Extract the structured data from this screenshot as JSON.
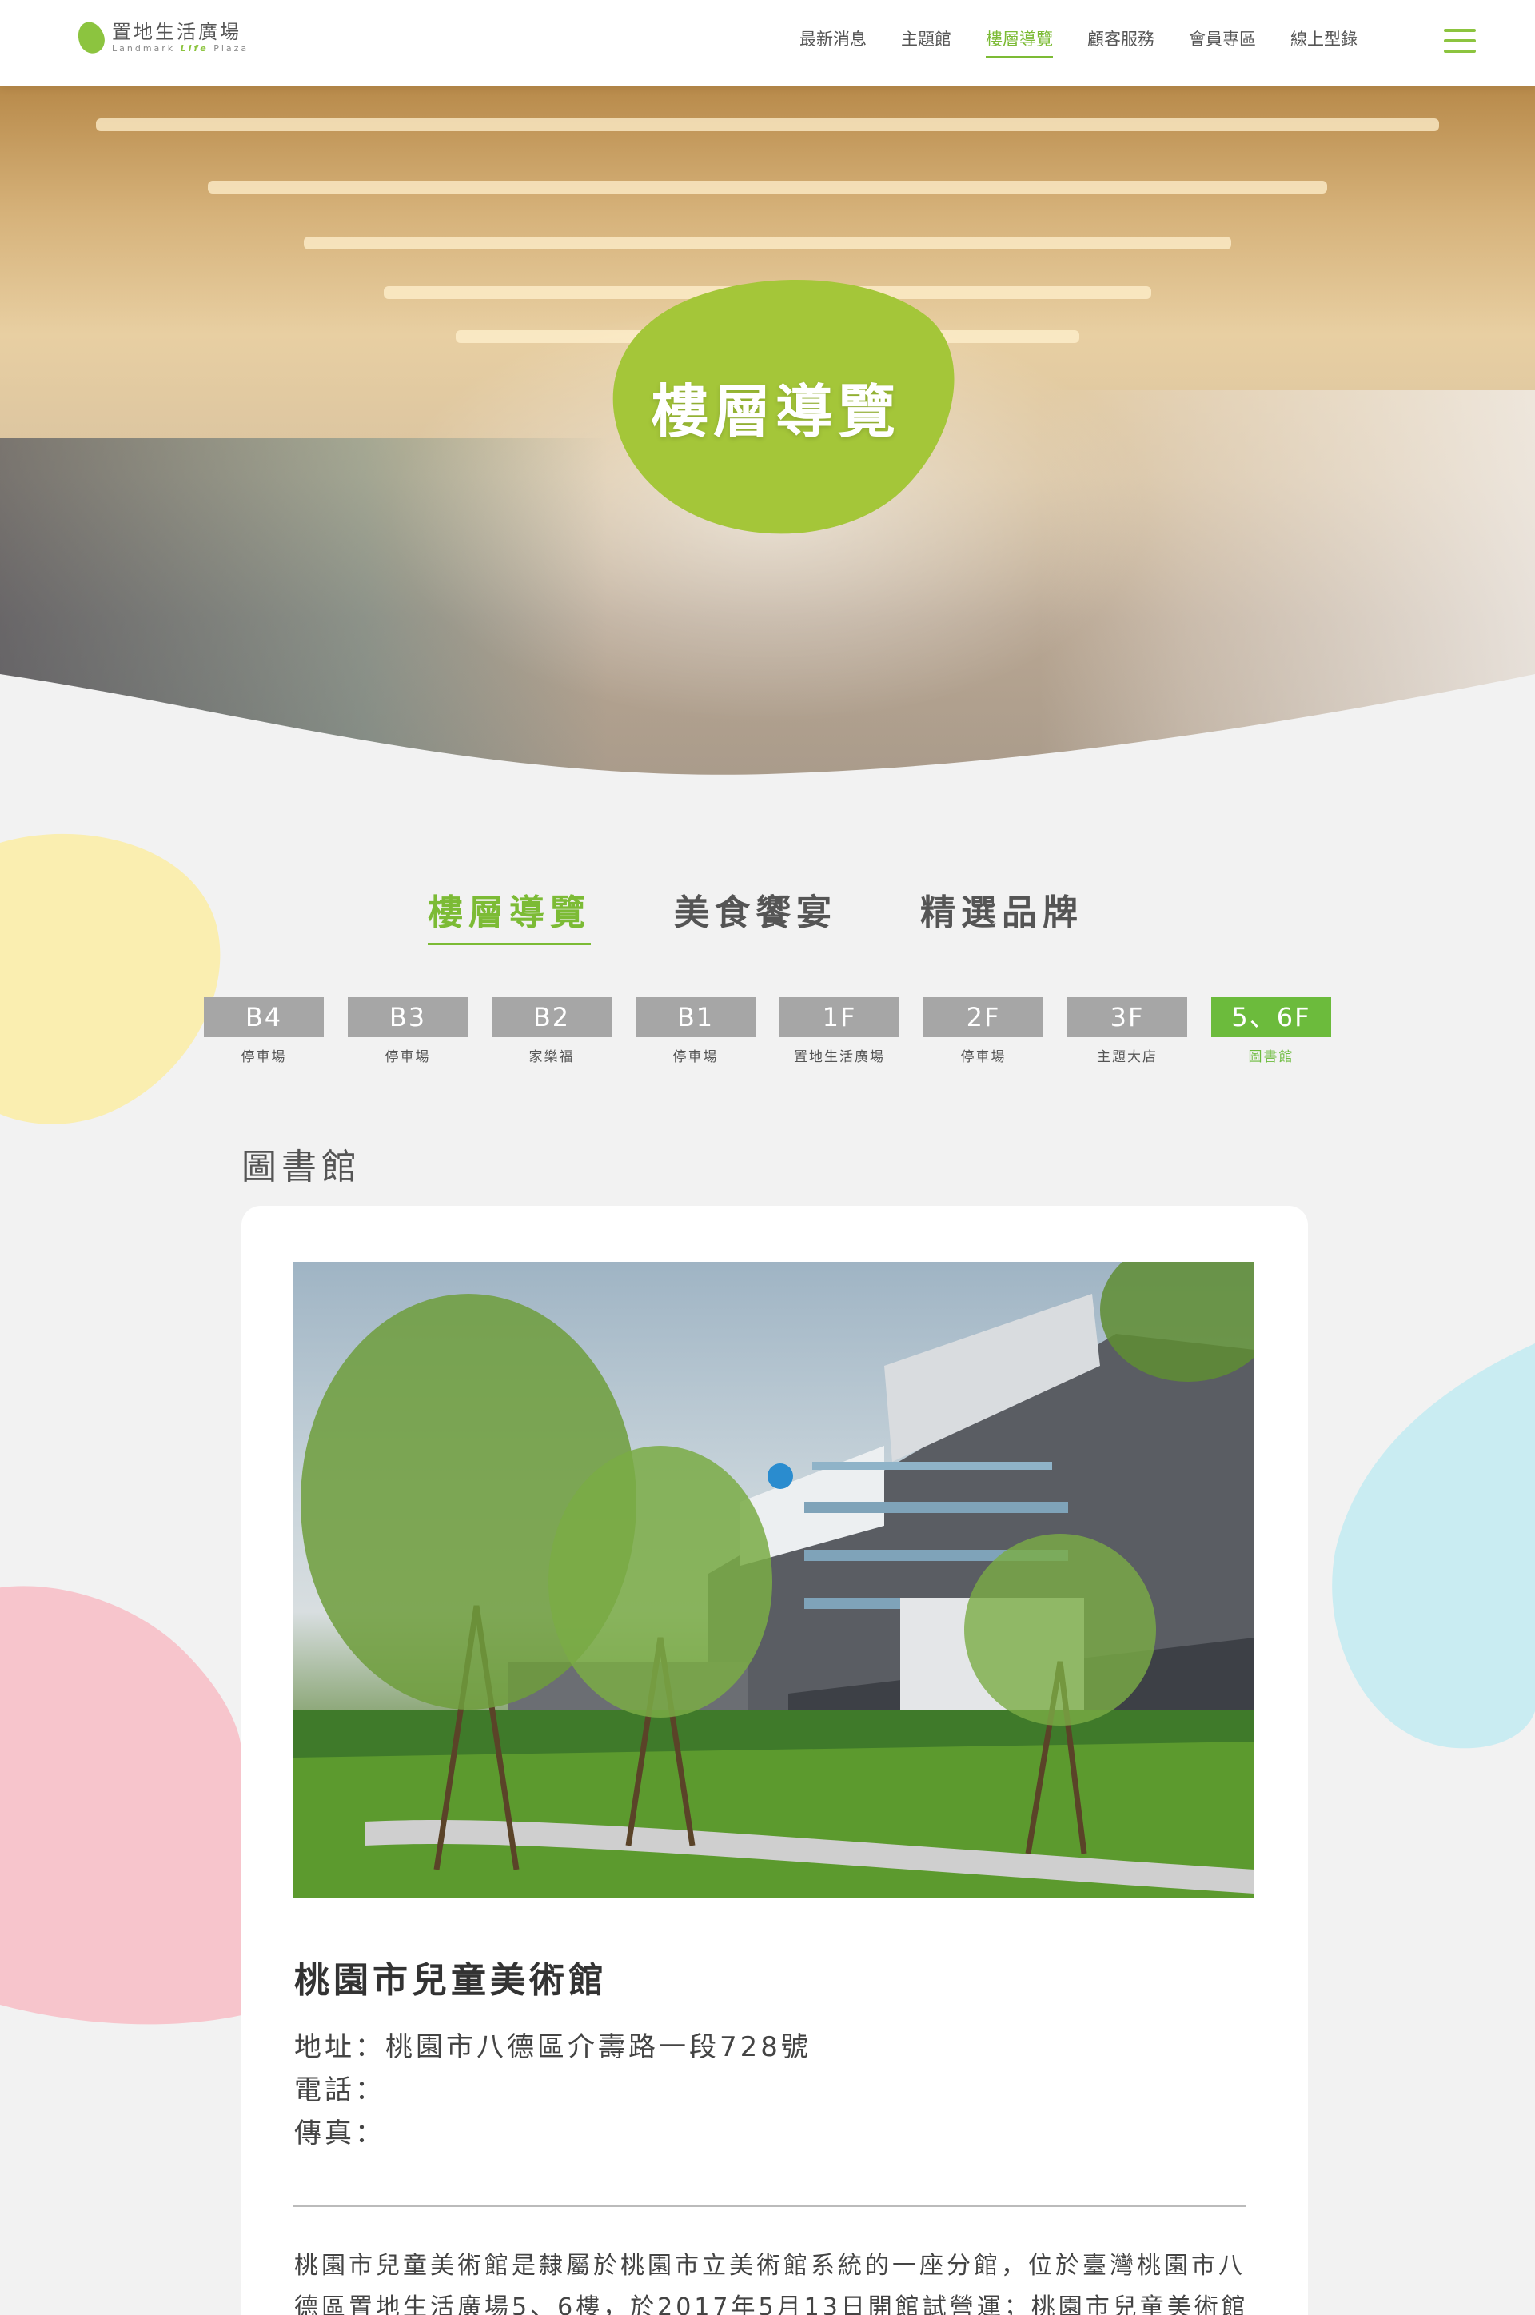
{
  "header": {
    "logo": {
      "name_cn": "置地生活廣場",
      "tagline": [
        "Landmark",
        "Life",
        "Plaza"
      ]
    },
    "nav": [
      "最新消息",
      "主題館",
      "樓層導覽",
      "顧客服務",
      "會員專區",
      "線上型錄"
    ],
    "active_nav": "樓層導覽"
  },
  "hero": {
    "title": "樓層導覽"
  },
  "category_tabs": [
    "樓層導覽",
    "美食饗宴",
    "精選品牌"
  ],
  "active_category": "樓層導覽",
  "floors": [
    {
      "label": "B4",
      "sub": "停車場"
    },
    {
      "label": "B3",
      "sub": "停車場"
    },
    {
      "label": "B2",
      "sub": "家樂福"
    },
    {
      "label": "B1",
      "sub": "停車場"
    },
    {
      "label": "1F",
      "sub": "置地生活廣場"
    },
    {
      "label": "2F",
      "sub": "停車場"
    },
    {
      "label": "3F",
      "sub": "主題大店"
    },
    {
      "label": "5、6F",
      "sub": "圖書館"
    }
  ],
  "active_floor": "5、6F",
  "section_title": "圖書館",
  "venue": {
    "name": "桃園市兒童美術館",
    "address": "地址：桃園市八德區介壽路一段728號",
    "phone": "電話：",
    "fax": "傳真：",
    "description": "桃園市兒童美術館是隸屬於桃園市立美術館系統的一座分館，位於臺灣桃園市八德區置地生活廣場5、6樓，於2017年5月13日開館試營運；桃園市兒童美術館"
  },
  "colors": {
    "brand_green": "#7cbb35",
    "floor_gray": "#a6a6a6",
    "blob_yellow": "#faeeb0",
    "blob_blue": "#c9ecf2",
    "blob_pink": "#f7c5cc"
  }
}
